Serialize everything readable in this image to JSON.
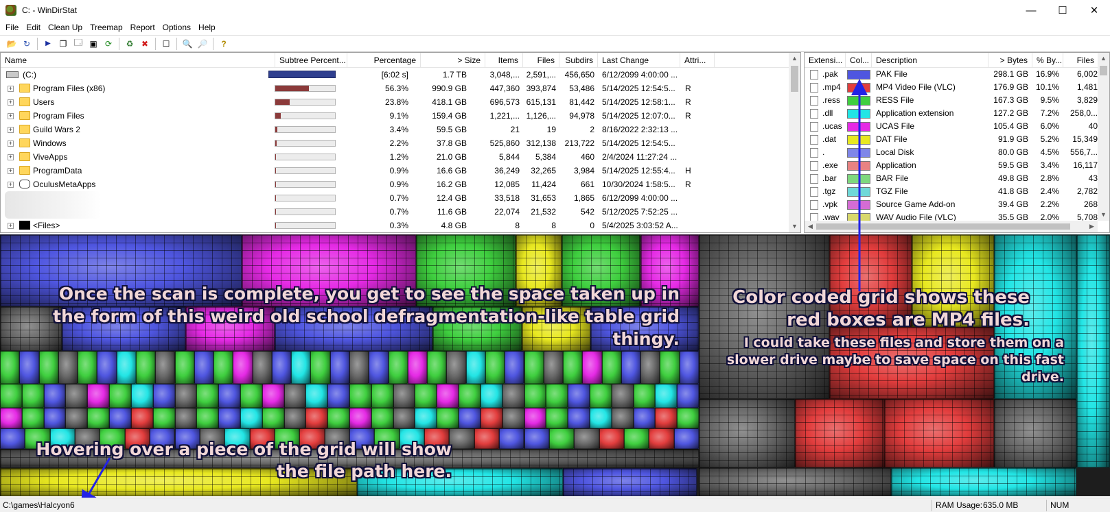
{
  "window": {
    "title": "C: - WinDirStat",
    "minimize": "—",
    "maximize": "☐",
    "close": "✕"
  },
  "menu": [
    "File",
    "Edit",
    "Clean Up",
    "Treemap",
    "Report",
    "Options",
    "Help"
  ],
  "toolbar": [
    {
      "icon": "open-folder-icon",
      "glyph": "📂"
    },
    {
      "icon": "rescan-icon",
      "glyph": "↻"
    },
    {
      "icon": "play-icon",
      "glyph": "▶"
    },
    {
      "icon": "copy-icon",
      "glyph": "❐"
    },
    {
      "icon": "explorer-icon",
      "glyph": "🗔"
    },
    {
      "icon": "command-prompt-icon",
      "glyph": "▣"
    },
    {
      "icon": "refresh-icon",
      "glyph": "⟳"
    },
    {
      "icon": "recycle-icon",
      "glyph": "♻"
    },
    {
      "icon": "delete-icon",
      "glyph": "✖"
    },
    {
      "icon": "new-folder-icon",
      "glyph": "☐"
    },
    {
      "icon": "zoom-in-icon",
      "glyph": "🔍"
    },
    {
      "icon": "zoom-out-icon",
      "glyph": "🔎"
    },
    {
      "icon": "help-icon",
      "glyph": "?"
    }
  ],
  "tree": {
    "columns": [
      "Name",
      "Subtree Percent...",
      "Percentage",
      "> Size",
      "Items",
      "Files",
      "Subdirs",
      "Last Change",
      "Attri..."
    ],
    "rows": [
      {
        "name": "(C:)",
        "kind": "drive",
        "subtree": 1.0,
        "percentage": "[6:02 s]",
        "size": "1.7 TB",
        "items": "3,048,...",
        "files": "2,591,...",
        "subdirs": "456,650",
        "last_change": "6/12/2099 4:00:00 ...",
        "attr": ""
      },
      {
        "name": "Program Files (x86)",
        "kind": "folder",
        "subtree": 0.563,
        "percentage": "56.3%",
        "size": "990.9 GB",
        "items": "447,360",
        "files": "393,874",
        "subdirs": "53,486",
        "last_change": "5/14/2025 12:54:5...",
        "attr": "R"
      },
      {
        "name": "Users",
        "kind": "folder",
        "subtree": 0.238,
        "percentage": "23.8%",
        "size": "418.1 GB",
        "items": "696,573",
        "files": "615,131",
        "subdirs": "81,442",
        "last_change": "5/14/2025 12:58:1...",
        "attr": "R"
      },
      {
        "name": "Program Files",
        "kind": "folder",
        "subtree": 0.091,
        "percentage": "9.1%",
        "size": "159.4 GB",
        "items": "1,221,...",
        "files": "1,126,...",
        "subdirs": "94,978",
        "last_change": "5/14/2025 12:07:0...",
        "attr": "R"
      },
      {
        "name": "Guild Wars 2",
        "kind": "folder",
        "subtree": 0.034,
        "percentage": "3.4%",
        "size": "59.5 GB",
        "items": "21",
        "files": "19",
        "subdirs": "2",
        "last_change": "8/16/2022 2:32:13 ...",
        "attr": ""
      },
      {
        "name": "Windows",
        "kind": "folder",
        "subtree": 0.022,
        "percentage": "2.2%",
        "size": "37.8 GB",
        "items": "525,860",
        "files": "312,138",
        "subdirs": "213,722",
        "last_change": "5/14/2025 12:54:5...",
        "attr": ""
      },
      {
        "name": "ViveApps",
        "kind": "folder",
        "subtree": 0.012,
        "percentage": "1.2%",
        "size": "21.0 GB",
        "items": "5,844",
        "files": "5,384",
        "subdirs": "460",
        "last_change": "2/4/2024 11:27:24 ...",
        "attr": ""
      },
      {
        "name": "ProgramData",
        "kind": "folder",
        "subtree": 0.009,
        "percentage": "0.9%",
        "size": "16.6 GB",
        "items": "36,249",
        "files": "32,265",
        "subdirs": "3,984",
        "last_change": "5/14/2025 12:55:4...",
        "attr": "H"
      },
      {
        "name": "OculusMetaApps",
        "kind": "vr",
        "subtree": 0.009,
        "percentage": "0.9%",
        "size": "16.2 GB",
        "items": "12,085",
        "files": "11,424",
        "subdirs": "661",
        "last_change": "10/30/2024 1:58:5...",
        "attr": "R"
      },
      {
        "name": "",
        "kind": "blurred",
        "subtree": 0.007,
        "percentage": "0.7%",
        "size": "12.4 GB",
        "items": "33,518",
        "files": "31,653",
        "subdirs": "1,865",
        "last_change": "6/12/2099 4:00:00 ...",
        "attr": ""
      },
      {
        "name": "",
        "kind": "blurred2",
        "subtree": 0.007,
        "percentage": "0.7%",
        "size": "11.6 GB",
        "items": "22,074",
        "files": "21,532",
        "subdirs": "542",
        "last_change": "5/12/2025 7:52:25 ...",
        "attr": ""
      },
      {
        "name": "<Files>",
        "kind": "files",
        "subtree": 0.003,
        "percentage": "0.3%",
        "size": "4.8 GB",
        "items": "8",
        "files": "8",
        "subdirs": "0",
        "last_change": "5/4/2025 3:03:52 A...",
        "attr": ""
      }
    ]
  },
  "extensions": {
    "columns": [
      "Extensi...",
      "Col...",
      "Description",
      "> Bytes",
      "% By...",
      "Files"
    ],
    "rows": [
      {
        "ext": ".pak",
        "color": "#4f56e0",
        "desc": "PAK File",
        "bytes": "298.1 GB",
        "pct": "16.9%",
        "files": "6,002"
      },
      {
        "ext": ".mp4",
        "color": "#e23d3d",
        "desc": "MP4 Video File (VLC)",
        "bytes": "176.9 GB",
        "pct": "10.1%",
        "files": "1,481"
      },
      {
        "ext": ".ress",
        "color": "#3fcf3f",
        "desc": "RESS File",
        "bytes": "167.3 GB",
        "pct": "9.5%",
        "files": "3,829"
      },
      {
        "ext": ".dll",
        "color": "#22e5e5",
        "desc": "Application extension",
        "bytes": "127.2 GB",
        "pct": "7.2%",
        "files": "258,0..."
      },
      {
        "ext": ".ucas",
        "color": "#e52ae5",
        "desc": "UCAS File",
        "bytes": "105.4 GB",
        "pct": "6.0%",
        "files": "40"
      },
      {
        "ext": ".dat",
        "color": "#e8e820",
        "desc": "DAT File",
        "bytes": "91.9 GB",
        "pct": "5.2%",
        "files": "15,349"
      },
      {
        "ext": ".",
        "color": "#7f86e8",
        "desc": "Local Disk",
        "bytes": "80.0 GB",
        "pct": "4.5%",
        "files": "556,7..."
      },
      {
        "ext": ".exe",
        "color": "#e88282",
        "desc": "Application",
        "bytes": "59.5 GB",
        "pct": "3.4%",
        "files": "16,117"
      },
      {
        "ext": ".bar",
        "color": "#7ed87e",
        "desc": "BAR File",
        "bytes": "49.8 GB",
        "pct": "2.8%",
        "files": "43"
      },
      {
        "ext": ".tgz",
        "color": "#6fd8d8",
        "desc": "TGZ File",
        "bytes": "41.8 GB",
        "pct": "2.4%",
        "files": "2,782"
      },
      {
        "ext": ".vpk",
        "color": "#d46cd4",
        "desc": "Source Game Add-on",
        "bytes": "39.4 GB",
        "pct": "2.2%",
        "files": "268"
      },
      {
        "ext": ".wav",
        "color": "#d8d86c",
        "desc": "WAV Audio File (VLC)",
        "bytes": "35.5 GB",
        "pct": "2.0%",
        "files": "5,708"
      }
    ]
  },
  "annotations": {
    "main": "Once the scan is complete, you get to see the space taken up in the form of this weird old school defragmentation-like table grid thingy.",
    "color_coded": "Color coded grid shows these red boxes are MP4 files.",
    "color_coded_sub": "I could take these files and store them on a slower drive maybe to save space on this fast drive.",
    "hover": "Hovering over a piece of the grid will show the file path here."
  },
  "status": {
    "path": "C:\\games\\Halcyon6",
    "ram_label": "RAM Usage:",
    "ram_value": "635.0 MB",
    "num": "NUM"
  },
  "colors": {
    "accent_arrow": "#2323e6",
    "bar_fill": "#8b3a3a",
    "drive_bar": "#2f3f8f"
  }
}
